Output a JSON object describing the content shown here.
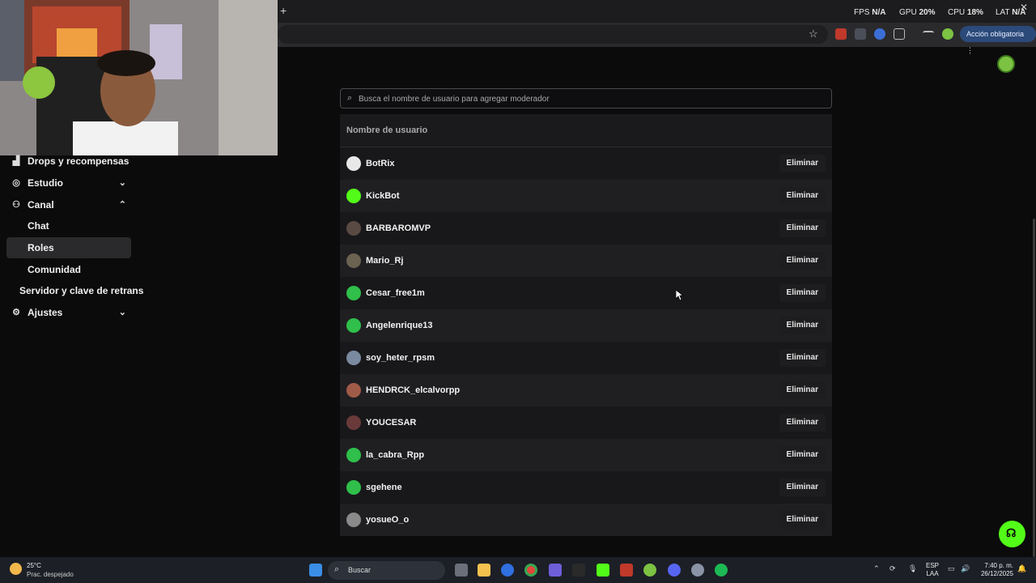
{
  "browser": {
    "new_tab_symbol": "+",
    "action_button": "Acción obligatoria",
    "minimize_symbol": "—",
    "close_symbol": "✕"
  },
  "overlay_stats": {
    "fps_label": "FPS",
    "fps_value": "N/A",
    "gpu_label": "GPU",
    "gpu_value": "20",
    "cpu_label": "CPU",
    "cpu_value": "18",
    "lat_label": "LAT",
    "lat_value": "N/A",
    "percent": "%"
  },
  "sidebar": {
    "items": [
      {
        "label": "Drops y recompensas",
        "icon": "gift-icon"
      },
      {
        "label": "Estudio",
        "icon": "studio-icon",
        "chevron": "⌄"
      },
      {
        "label": "Canal",
        "icon": "users-icon",
        "chevron": "⌃"
      },
      {
        "label": "Chat"
      },
      {
        "label": "Roles"
      },
      {
        "label": "Comunidad"
      },
      {
        "label": "Servidor y clave de retrans"
      },
      {
        "label": "Ajustes",
        "icon": "gear-icon",
        "chevron": "⌄"
      }
    ]
  },
  "search": {
    "placeholder": "Busca el nombre de usuario para agregar moderador"
  },
  "table": {
    "header": "Nombre de usuario",
    "delete_label": "Eliminar",
    "rows": [
      {
        "username": "BotRix",
        "avatar_color": "#e8e8e8"
      },
      {
        "username": "KickBot",
        "avatar_color": "#53fc18"
      },
      {
        "username": "BARBAROMVP",
        "avatar_color": "#5a4a44"
      },
      {
        "username": "Mario_Rj",
        "avatar_color": "#6b6250"
      },
      {
        "username": "Cesar_free1m",
        "avatar_color": "#2fbf4a"
      },
      {
        "username": "Angelenrique13",
        "avatar_color": "#2fbf4a"
      },
      {
        "username": "soy_heter_rpsm",
        "avatar_color": "#7a8aa0"
      },
      {
        "username": "HENDRCK_elcalvorpp",
        "avatar_color": "#a05a48"
      },
      {
        "username": "YOUCESAR",
        "avatar_color": "#6a3a3a"
      },
      {
        "username": "la_cabra_Rpp",
        "avatar_color": "#2fbf4a"
      },
      {
        "username": "sgehene",
        "avatar_color": "#2fbf4a"
      },
      {
        "username": "yosueO_o",
        "avatar_color": "#8a8a8a"
      }
    ]
  },
  "taskbar": {
    "temperature": "25°C",
    "weather": "Prac. despejado",
    "search_label": "Buscar",
    "lang_line1": "ESP",
    "lang_line2": "LAA",
    "time": "7:40 p. m.",
    "date": "26/12/2025"
  },
  "colors": {
    "accent": "#53fc18",
    "background": "#0b0b0c"
  }
}
